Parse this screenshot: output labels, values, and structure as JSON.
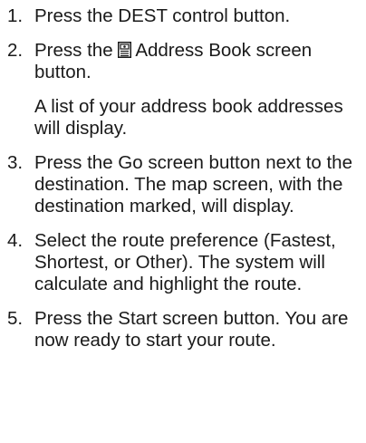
{
  "steps": [
    {
      "number": "1.",
      "text": "Press the DEST control button."
    },
    {
      "number": "2.",
      "text_before_icon": "Press the",
      "icon": "address-book-icon",
      "text_after_icon": "Address Book screen button."
    },
    {
      "number": "",
      "note": "A list of your address book addresses will display."
    },
    {
      "number": "3.",
      "text": "Press the Go screen button next to the destination. The map screen, with the destination marked, will display."
    },
    {
      "number": "4.",
      "text": "Select the route preference (Fastest, Shortest, or Other). The system will calculate and highlight the route."
    },
    {
      "number": "5.",
      "text": "Press the Start screen button. You are now ready to start your route."
    }
  ]
}
